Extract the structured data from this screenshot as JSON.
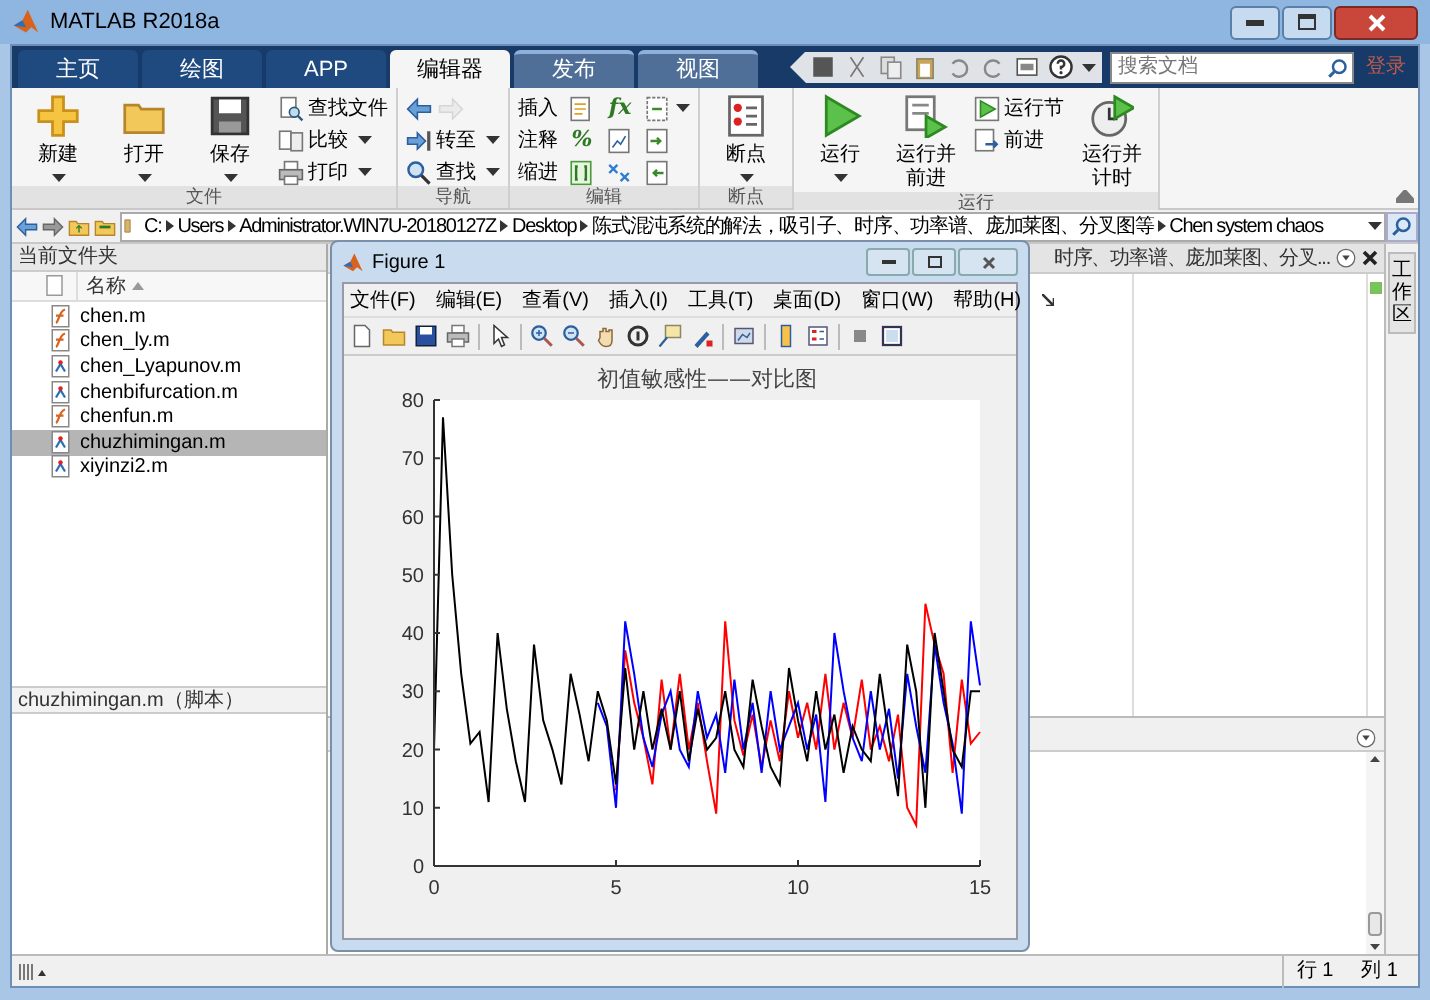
{
  "window": {
    "title": "MATLAB R2018a"
  },
  "tabs": [
    {
      "label": "主页",
      "selected": false,
      "contextual": false
    },
    {
      "label": "绘图",
      "selected": false,
      "contextual": false
    },
    {
      "label": "APP",
      "selected": false,
      "contextual": false
    },
    {
      "label": "编辑器",
      "selected": true,
      "contextual": false
    },
    {
      "label": "发布",
      "selected": false,
      "contextual": true
    },
    {
      "label": "视图",
      "selected": false,
      "contextual": true
    }
  ],
  "search": {
    "placeholder": "搜索文档"
  },
  "sign_in": "登录",
  "ribbon": [
    {
      "label": "文件",
      "columns": [
        [
          {
            "kind": "large",
            "label": "新建",
            "dropdown": true
          }
        ],
        [
          {
            "kind": "large",
            "label": "打开",
            "dropdown": true
          }
        ],
        [
          {
            "kind": "large",
            "label": "保存",
            "dropdown": true
          }
        ],
        [
          {
            "kind": "small",
            "label": "查找文件",
            "dropdown": false
          },
          {
            "kind": "small",
            "label": "比较",
            "dropdown": true
          },
          {
            "kind": "small",
            "label": "打印",
            "dropdown": true
          }
        ]
      ]
    },
    {
      "label": "导航",
      "columns": [
        [
          {
            "kind": "row",
            "items": [
              {
                "kind": "icon",
                "disabled": false
              },
              {
                "kind": "icon",
                "disabled": true
              }
            ]
          },
          {
            "kind": "small",
            "label": "转至",
            "dropdown": true
          },
          {
            "kind": "small",
            "label": "查找",
            "dropdown": true
          }
        ]
      ]
    },
    {
      "label": "编辑",
      "columns": [
        [
          {
            "kind": "text",
            "label": "插入"
          },
          {
            "kind": "text",
            "label": "注释"
          },
          {
            "kind": "text",
            "label": "缩进"
          }
        ],
        [
          {
            "kind": "icon",
            "disabled": false
          },
          {
            "kind": "glyph",
            "label": "%"
          },
          {
            "kind": "icon",
            "disabled": false
          }
        ],
        [
          {
            "kind": "glyph",
            "label": "fx"
          },
          {
            "kind": "icon",
            "disabled": false
          },
          {
            "kind": "icon",
            "disabled": false
          }
        ],
        [
          {
            "kind": "icon",
            "disabled": false,
            "dropdown": true
          },
          {
            "kind": "icon",
            "disabled": false
          },
          {
            "kind": "icon",
            "disabled": false
          }
        ]
      ]
    },
    {
      "label": "断点",
      "columns": [
        [
          {
            "kind": "large",
            "label": "断点",
            "dropdown": true
          }
        ]
      ]
    },
    {
      "label": "运行",
      "columns": [
        [
          {
            "kind": "large",
            "label": "运行",
            "dropdown": true
          }
        ],
        [
          {
            "kind": "large",
            "label": "运行并前进",
            "dropdown": false
          }
        ],
        [
          {
            "kind": "small",
            "label": "运行节",
            "dropdown": false
          },
          {
            "kind": "small",
            "label": "前进",
            "dropdown": false
          }
        ],
        [
          {
            "kind": "large",
            "label": "运行并计时",
            "dropdown": false
          }
        ]
      ]
    }
  ],
  "address_bar": {
    "path": [
      "C:",
      "Users",
      "Administrator.WIN7U-20180127Z",
      "Desktop",
      "陈式混沌系统的解法，吸引子、时序、功率谱、庞加莱图、分叉图等",
      "Chen system chaos"
    ]
  },
  "current_folder": {
    "title": "当前文件夹",
    "column": "名称",
    "files": [
      {
        "name": "chen.m",
        "kind": "function",
        "selected": false
      },
      {
        "name": "chen_ly.m",
        "kind": "function",
        "selected": false
      },
      {
        "name": "chen_Lyapunov.m",
        "kind": "script",
        "selected": false
      },
      {
        "name": "chenbifurcation.m",
        "kind": "script",
        "selected": false
      },
      {
        "name": "chenfun.m",
        "kind": "function",
        "selected": false
      },
      {
        "name": "chuzhimingan.m",
        "kind": "script",
        "selected": true
      },
      {
        "name": "xiyinzi2.m",
        "kind": "script",
        "selected": false
      }
    ],
    "details": "chuzhimingan.m（脚本）"
  },
  "editor": {
    "tab": "时序、功率谱、庞加莱图、分叉..."
  },
  "side_tab": "工作区",
  "status_bar": {
    "line": "行 1",
    "column": "列 1"
  },
  "figure": {
    "title": "Figure 1",
    "menus": [
      "文件(F)",
      "编辑(E)",
      "查看(V)",
      "插入(I)",
      "工具(T)",
      "桌面(D)",
      "窗口(W)",
      "帮助(H)"
    ],
    "chart_data": {
      "type": "line",
      "title": "初值敏感性——对比图",
      "x": [
        0,
        0.25,
        0.5,
        0.75,
        1,
        1.25,
        1.5,
        1.75,
        2,
        2.25,
        2.5,
        2.75,
        3,
        3.25,
        3.5,
        3.75,
        4,
        4.25,
        4.5,
        4.75,
        5,
        5.25,
        5.5,
        5.75,
        6,
        6.25,
        6.5,
        6.75,
        7,
        7.25,
        7.5,
        7.75,
        8,
        8.25,
        8.5,
        8.75,
        9,
        9.25,
        9.5,
        9.75,
        10,
        10.25,
        10.5,
        10.75,
        11,
        11.25,
        11.5,
        11.75,
        12,
        12.25,
        12.5,
        12.75,
        13,
        13.25,
        13.5,
        13.75,
        14,
        14.25,
        14.5,
        14.75,
        15
      ],
      "series": [
        {
          "color": "#ff0000",
          "values": [
            null,
            null,
            null,
            null,
            null,
            null,
            null,
            null,
            null,
            null,
            null,
            null,
            null,
            null,
            null,
            null,
            null,
            null,
            null,
            null,
            13,
            37,
            28,
            22,
            14,
            32,
            20,
            33,
            20,
            28,
            18,
            9,
            42,
            25,
            19,
            26,
            17,
            25,
            18,
            30,
            22,
            28,
            20,
            33,
            20,
            28,
            22,
            32,
            20,
            24,
            18,
            26,
            10,
            7,
            45,
            38,
            33,
            16,
            32,
            21,
            23
          ]
        },
        {
          "color": "#0000ff",
          "values": [
            null,
            null,
            null,
            null,
            null,
            null,
            null,
            null,
            null,
            null,
            null,
            null,
            null,
            null,
            null,
            null,
            null,
            null,
            28,
            24,
            10,
            42,
            33,
            22,
            17,
            26,
            30,
            20,
            17,
            30,
            22,
            26,
            16,
            32,
            20,
            28,
            16,
            30,
            20,
            24,
            28,
            20,
            26,
            11,
            40,
            30,
            22,
            18,
            30,
            20,
            27,
            15,
            33,
            24,
            16,
            38,
            28,
            21,
            9,
            42,
            31
          ]
        },
        {
          "color": "#000000",
          "values": [
            20,
            77,
            50,
            33,
            21,
            23,
            11,
            40,
            27,
            18,
            11,
            38,
            25,
            20,
            14,
            33,
            26,
            18,
            30,
            25,
            14,
            34,
            20,
            30,
            20,
            27,
            20,
            30,
            18,
            27,
            20,
            22,
            30,
            20,
            17,
            32,
            24,
            17,
            14,
            34,
            25,
            18,
            30,
            20,
            26,
            16,
            24,
            20,
            18,
            33,
            22,
            12,
            38,
            30,
            10,
            40,
            30,
            20,
            17,
            30,
            30
          ]
        }
      ],
      "xlim": [
        0,
        15
      ],
      "ylim": [
        0,
        80
      ],
      "xticks": [
        0,
        5,
        10,
        15
      ],
      "yticks": [
        80,
        70,
        60,
        50,
        40,
        30,
        20,
        10,
        0
      ]
    }
  }
}
